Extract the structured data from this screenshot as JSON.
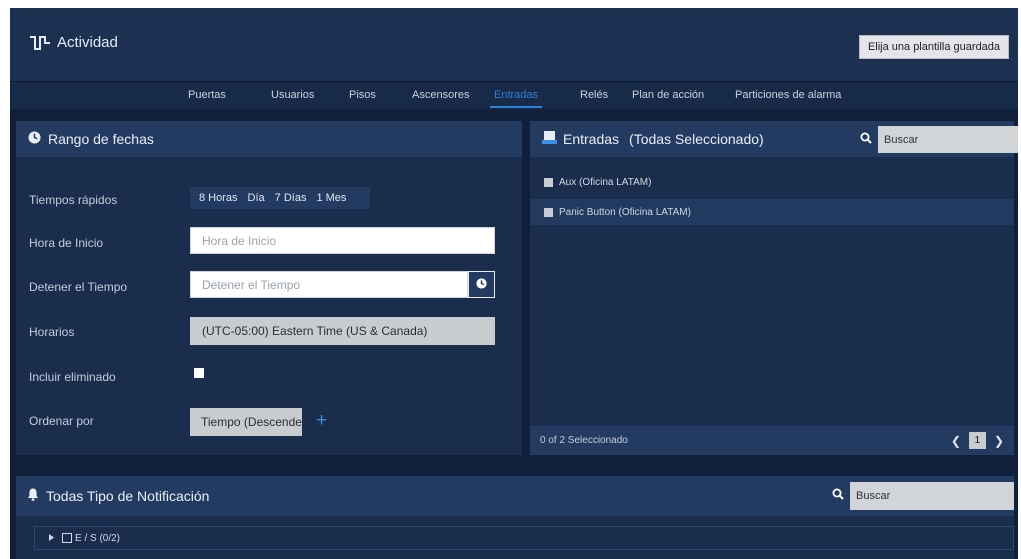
{
  "header": {
    "title": "Actividad",
    "template_button": "Elija una plantilla guardada"
  },
  "tabs": [
    {
      "label": "Puertas",
      "active": false
    },
    {
      "label": "Usuarios",
      "active": false
    },
    {
      "label": "Pisos",
      "active": false
    },
    {
      "label": "Ascensores",
      "active": false
    },
    {
      "label": "Entradas",
      "active": true
    },
    {
      "label": "Relés",
      "active": false
    },
    {
      "label": "Plan de acción",
      "active": false
    },
    {
      "label": "Particiones de alarma",
      "active": false
    }
  ],
  "date_panel": {
    "title": "Rango de fechas",
    "quick_times_label": "Tiempos rápidos",
    "quick_times": [
      "8 Horas",
      "Día",
      "7 Días",
      "1 Mes"
    ],
    "start_label": "Hora de Inicio",
    "start_placeholder": "Hora de Inicio",
    "stop_label": "Detener el Tiempo",
    "stop_placeholder": "Detener el Tiempo",
    "timezone_label": "Horarios",
    "timezone_value": "(UTC-05:00) Eastern Time (US & Canada)",
    "include_deleted_label": "Incluir eliminado",
    "include_deleted_checked": false,
    "sort_label": "Ordenar por",
    "sort_value": "Tiempo (Descendent",
    "add_symbol": "+"
  },
  "inputs_panel": {
    "title": "Entradas",
    "subtitle": "(Todas Seleccionado)",
    "search_placeholder": "Buscar",
    "items": [
      {
        "label": "Aux (Oficina LATAM)"
      },
      {
        "label": "Panic Button (Oficina LATAM)"
      }
    ],
    "selected_count": "0 of 2 Seleccionado",
    "page": "1"
  },
  "notifications_panel": {
    "title": "Todas Tipo de Notificación",
    "search_placeholder": "Buscar",
    "tree_item": "E / S (0/2)"
  },
  "colors": {
    "background": "#10203a",
    "panel": "#1a2d4c",
    "panel_header": "#243b61",
    "accent": "#2f80d8"
  }
}
